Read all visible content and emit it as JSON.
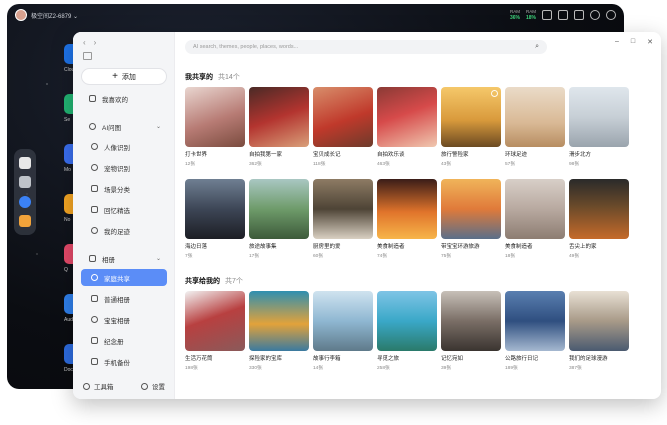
{
  "desktop": {
    "device_name": "极空间Z2-6879 ⌄",
    "stats": [
      {
        "label": "RAM",
        "value": "36%"
      },
      {
        "label": "RAM",
        "value": "18%"
      }
    ],
    "apps": [
      {
        "label": "Cloud",
        "color": "#1e73e8"
      },
      {
        "label": "Se",
        "color": "#22b573"
      },
      {
        "label": "Mo",
        "color": "#3a6ff0"
      },
      {
        "label": "No",
        "color": "#f5a623"
      },
      {
        "label": "Q",
        "color": "#e64a6a"
      },
      {
        "label": "Audi",
        "color": "#2f80ed"
      },
      {
        "label": "Doc",
        "color": "#2d6cdf"
      }
    ]
  },
  "window": {
    "nav": {
      "back": "‹",
      "forward": "›"
    },
    "search_placeholder": "AI search, themes, people, places, words...",
    "controls": {
      "minimize": "–",
      "maximize": "□",
      "close": "✕"
    },
    "add_label": "添加",
    "sidebar": {
      "favorites": "我喜欢的",
      "ai_group": "AI问图",
      "ai_items": [
        "人像识别",
        "宠物识别",
        "场景分类",
        "回忆精选",
        "我的足迹"
      ],
      "album_group": "相册",
      "album_items": [
        "家庭共享",
        "普通相册",
        "宝宝相册",
        "纪念册",
        "手机备份"
      ],
      "active_item": "家庭共享",
      "toolbox": "工具箱",
      "settings": "设置"
    },
    "shared_by_me": {
      "title": "我共享的",
      "count": "共14个",
      "albums": [
        {
          "name": "打卡世界",
          "count": "12张"
        },
        {
          "name": "自拍我第一家",
          "count": "362张"
        },
        {
          "name": "宝贝成长记",
          "count": "118张"
        },
        {
          "name": "自拍欢乐谈",
          "count": "463张"
        },
        {
          "name": "旅行警险家",
          "count": "43张"
        },
        {
          "name": "环球足迹",
          "count": "57张"
        },
        {
          "name": "滑步北方",
          "count": "98张"
        },
        {
          "name": "海边日落",
          "count": "7张"
        },
        {
          "name": "旅途故事集",
          "count": "17张"
        },
        {
          "name": "厨房里的爱",
          "count": "60张"
        },
        {
          "name": "美食制造者",
          "count": "74张"
        },
        {
          "name": "带宝宝环游旅游",
          "count": "75张"
        },
        {
          "name": "美食制造者",
          "count": "18张"
        },
        {
          "name": "舌尖上的家",
          "count": "49张"
        }
      ]
    },
    "shared_with_me": {
      "title": "共享给我的",
      "count": "共7个",
      "albums": [
        {
          "name": "生活万花筒",
          "count": "198张"
        },
        {
          "name": "探险家的宝库",
          "count": "330张"
        },
        {
          "name": "故事行李箱",
          "count": "14张"
        },
        {
          "name": "寻觅之旅",
          "count": "258张"
        },
        {
          "name": "记忆宛如",
          "count": "39张"
        },
        {
          "name": "公路旅行日记",
          "count": "189张"
        },
        {
          "name": "我们的足球漫游",
          "count": "387张"
        }
      ]
    }
  }
}
